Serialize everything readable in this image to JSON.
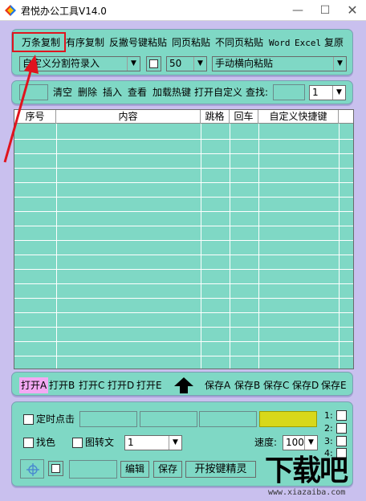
{
  "window": {
    "title": "君悦办公工具V14.0",
    "minimize_glyph": "—",
    "maximize_glyph": "☐",
    "close_glyph": "✕"
  },
  "toolbar1": {
    "items": [
      "万条复制",
      "有序复制",
      "反撇号键粘贴",
      "同页粘贴",
      "不同页粘贴",
      "Word",
      "Excel",
      "复原"
    ],
    "split_combo": "自定义分割符录入",
    "number_combo": "50",
    "paste_combo": "手动横向粘贴",
    "dropdown_glyph": "▼"
  },
  "toolbar2": {
    "items": [
      "清空",
      "删除",
      "插入",
      "查看",
      "加载热键",
      "打开自定义"
    ],
    "search_label": "查找:",
    "page_combo": "1"
  },
  "table": {
    "columns": [
      "序号",
      "内容",
      "跳格",
      "回车",
      "自定义快捷键"
    ],
    "rows": []
  },
  "file_bar": {
    "open": [
      "打开A",
      "打开B",
      "打开C",
      "打开D",
      "打开E"
    ],
    "save": [
      "保存A",
      "保存B",
      "保存C",
      "保存D",
      "保存E"
    ],
    "up_icon": "up-arrow-icon"
  },
  "bottom": {
    "timed_click_label": "定时点击",
    "find_color_label": "找色",
    "image_to_text_label": "图转文",
    "combo_value": "1",
    "speed_label": "速度:",
    "speed_value": "100",
    "edit_button": "编辑",
    "save_button": "保存",
    "genie_button": "开按键精灵",
    "side_numbers": [
      "1:",
      "2:",
      "3:",
      "4:"
    ],
    "highlight_color": "#d8d81a"
  },
  "watermark": {
    "main": "下载吧",
    "sub": "www.xiazaiba.com"
  },
  "colors": {
    "panel": "#7fd8c5",
    "background": "#c9c0ee",
    "annotation": "#e0141e",
    "active_tab": "#f3a9f3"
  }
}
